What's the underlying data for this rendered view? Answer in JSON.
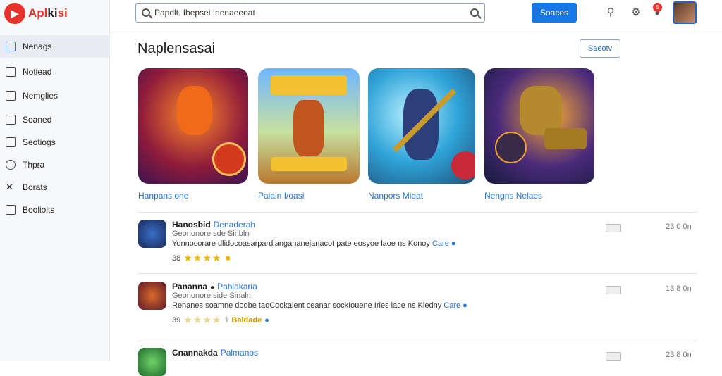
{
  "app": {
    "logo_text_a": "Apl",
    "logo_text_b": "ki",
    "logo_text_c": "si"
  },
  "sidebar": {
    "items": [
      {
        "label": "Nenags",
        "icon": "pencil-icon",
        "active": true
      },
      {
        "label": "Notiead",
        "icon": "square-icon"
      },
      {
        "label": "Nemglies",
        "icon": "square-icon"
      },
      {
        "label": "Soaned",
        "icon": "check-square-icon"
      },
      {
        "label": "Seotiogs",
        "icon": "check-box-icon"
      },
      {
        "label": "Thpra",
        "icon": "circle-icon"
      },
      {
        "label": "Borats",
        "icon": "tools-icon"
      },
      {
        "label": "Booliolts",
        "icon": "file-icon"
      }
    ]
  },
  "header": {
    "search_value": "Papdlt. Ihepsei Inenaeeoat",
    "primary_button": "Soaces",
    "notification_count": "5"
  },
  "section": {
    "title": "Naplensasai",
    "action_button": "Saeotv"
  },
  "featured": [
    {
      "name": "Hanpans one"
    },
    {
      "name": "Paiain I/oasi"
    },
    {
      "name": "Nanpors Mieat"
    },
    {
      "name": "Nengns Nelaes"
    }
  ],
  "list": [
    {
      "title": "Hanosbid",
      "tag": "Denaderah",
      "sub": "Geononore sde Sinbln",
      "desc": "Yonnocorare dlidocoasarpardiangananejanacot pate eosyoe laoe ns Konoy",
      "link": "Care",
      "rating": "38",
      "extra": "",
      "time": "23 0 0n"
    },
    {
      "title": "Pananna",
      "tag": "Pahlakaria",
      "sub": "Geononore side Sinaln",
      "desc": "Renanes soamne doobe taoCookalent ceanar sockIouene Iries lace ns Kiedny",
      "link": "Care",
      "rating": "39",
      "extra": "Baidade",
      "time": "13 8 0n"
    },
    {
      "title": "Cnannakda",
      "tag": "Palmanos",
      "sub": "",
      "desc": "",
      "link": "",
      "rating": "",
      "extra": "",
      "time": "23 8 0n"
    }
  ]
}
